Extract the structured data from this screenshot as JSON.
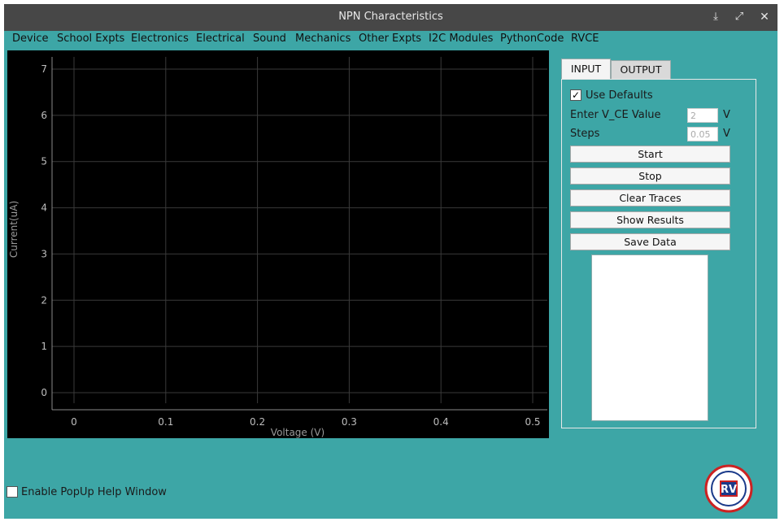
{
  "window": {
    "title": "NPN Characteristics"
  },
  "menu": [
    "Device",
    "School Expts",
    "Electronics",
    "Electrical",
    "Sound",
    "Mechanics",
    "Other Expts",
    "I2C Modules",
    "PythonCode",
    "RVCE"
  ],
  "plot": {
    "background": "#000000",
    "xlabel": "Voltage (V)",
    "ylabel": "Current(uA)",
    "x_ticks": [
      "0",
      "0.1",
      "0.2",
      "0.3",
      "0.4",
      "0.5"
    ],
    "y_ticks": [
      "0",
      "1",
      "2",
      "3",
      "4",
      "5",
      "6",
      "7"
    ]
  },
  "chart_data": {
    "type": "line",
    "title": "",
    "xlabel": "Voltage (V)",
    "ylabel": "Current(uA)",
    "xlim": [
      -0.02,
      0.52
    ],
    "ylim": [
      -0.3,
      7.2
    ],
    "x_ticks": [
      0,
      0.1,
      0.2,
      0.3,
      0.4,
      0.5
    ],
    "y_ticks": [
      0,
      1,
      2,
      3,
      4,
      5,
      6,
      7
    ],
    "grid": true,
    "series": []
  },
  "tabs": {
    "input": "INPUT",
    "output": "OUTPUT"
  },
  "input_panel": {
    "use_defaults_label": "Use Defaults",
    "use_defaults_checked": "✓",
    "vce_label": "Enter V_CE Value",
    "vce_value": "2",
    "vce_unit": "V",
    "steps_label": "Steps",
    "steps_value": "0.05",
    "steps_unit": "V",
    "buttons": {
      "start": "Start",
      "stop": "Stop",
      "clear": "Clear Traces",
      "results": "Show Results",
      "save": "Save Data"
    }
  },
  "footer": {
    "help_label": "Enable PopUp Help Window"
  },
  "colors": {
    "background": "#3da6a6",
    "titlebar": "#474747",
    "grid": "#3a3a3a",
    "axis": "#8a8a8a"
  },
  "icons": {
    "minimize": "download-icon",
    "maximize": "expand-icon",
    "close": "close-icon",
    "logo": "rv-logo-icon"
  }
}
